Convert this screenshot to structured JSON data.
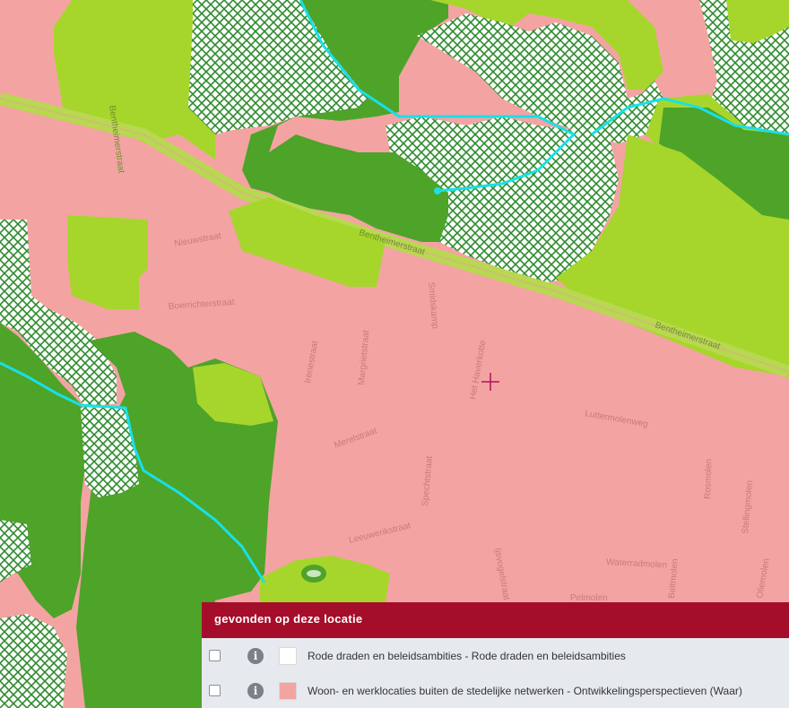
{
  "map": {
    "streets": [
      "Bentheimerstraat",
      "Bentheimerstraat",
      "Bentheimerstraat",
      "Nieuwstraat",
      "Boerrichterstraat",
      "Irenestraat",
      "Margrietstraat",
      "Smidskamp",
      "Het Haverkotte",
      "Luttermolenweg",
      "Merelstraat",
      "Spechtstraat",
      "Leeuwerikstraat",
      "Rosmolen",
      "Stellingmolen",
      "Waterradmolen",
      "Pelmolen",
      "Ijsvogelstraat",
      "Beltmolen",
      "Oliemolen"
    ],
    "marker_icon": "crosshair-icon",
    "colors": {
      "urban": "#f4a3a3",
      "light_green": "#a6d62c",
      "dark_green": "#4ea329",
      "hatch": "#2e8b2e",
      "water": "#18e0e8"
    }
  },
  "panel": {
    "header": "gevonden op deze locatie",
    "rows": [
      {
        "label": "Rode draden en beleidsambities - Rode draden en beleidsambities",
        "swatch_color": "#ffffff",
        "icon": "info-icon",
        "info_glyph": "i"
      },
      {
        "label": "Woon- en werklocaties buiten de stedelijke netwerken - Ontwikkelingsperspectieven (Waar)",
        "swatch_color": "#f4a3a3",
        "icon": "info-icon",
        "info_glyph": "i"
      }
    ]
  }
}
